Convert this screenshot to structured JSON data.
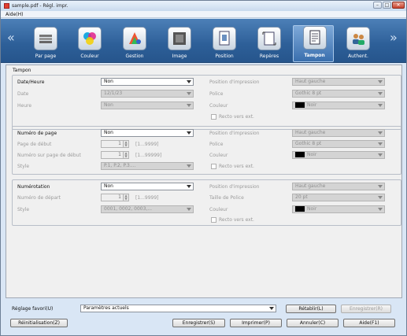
{
  "window": {
    "title": "sample.pdf - Régl. impr.",
    "minimize": "–",
    "maximize": "□",
    "close": "✕"
  },
  "menu": {
    "help": "Aide(H)"
  },
  "toolbar": {
    "prev": "«",
    "next": "»",
    "items": [
      {
        "label": "Par page",
        "icon": "pages-stack-icon"
      },
      {
        "label": "Couleur",
        "icon": "color-circles-icon"
      },
      {
        "label": "Gestion",
        "icon": "color-wheel-icon"
      },
      {
        "label": "Image",
        "icon": "image-icon"
      },
      {
        "label": "Position",
        "icon": "position-icon"
      },
      {
        "label": "Repères",
        "icon": "marks-icon"
      },
      {
        "label": "Tampon",
        "icon": "stamp-doc-icon",
        "selected": true
      },
      {
        "label": "Authent.",
        "icon": "users-icon"
      }
    ]
  },
  "panel": {
    "title": "Tampon"
  },
  "date": {
    "header": "Date/Heure",
    "value": "Non",
    "date_label": "Date",
    "date_value": "12/1/23",
    "time_label": "Heure",
    "time_value": "Non",
    "pos_label": "Position d'impression",
    "pos_value": "Haut gauche",
    "font_label": "Police",
    "font_value": "Gothic 8 pt",
    "color_label": "Couleur",
    "color_value": "Noir",
    "duplex": "Recto vers ext."
  },
  "page": {
    "header": "Numéro de page",
    "value": "Non",
    "start_label": "Page de début",
    "start_value": "1",
    "start_range": "[1...9999]",
    "cover_label": "Numéro sur page de début",
    "cover_value": "1",
    "cover_range": "[1...99999]",
    "style_label": "Style",
    "style_value": "P.1, P.2, P.3....",
    "pos_label": "Position d'impression",
    "pos_value": "Haut gauche",
    "font_label": "Police",
    "font_value": "Gothic 8 pt",
    "color_label": "Couleur",
    "color_value": "Noir",
    "duplex": "Recto vers ext."
  },
  "number": {
    "header": "Numérotation",
    "value": "Non",
    "start_label": "Numéro de départ",
    "start_value": "1",
    "start_range": "[1...9999]",
    "style_label": "Style",
    "style_value": "0001, 0002, 0003,...",
    "pos_label": "Position d'impression",
    "pos_value": "Haut gauche",
    "size_label": "Taille de Police",
    "size_value": "20 pt",
    "color_label": "Couleur",
    "color_value": "Noir",
    "duplex": "Recto vers ext."
  },
  "footer": {
    "fav_label": "Réglage favori(U)",
    "fav_value": "Paramètres actuels",
    "restore": "Rétablir(L)",
    "save_fav": "Enregistrer(R)",
    "reset": "Réinitialisation(Z)",
    "save": "Enregistrer(S)",
    "print": "Imprimer(P)",
    "cancel": "Annuler(C)",
    "help": "Aide(F1)"
  }
}
